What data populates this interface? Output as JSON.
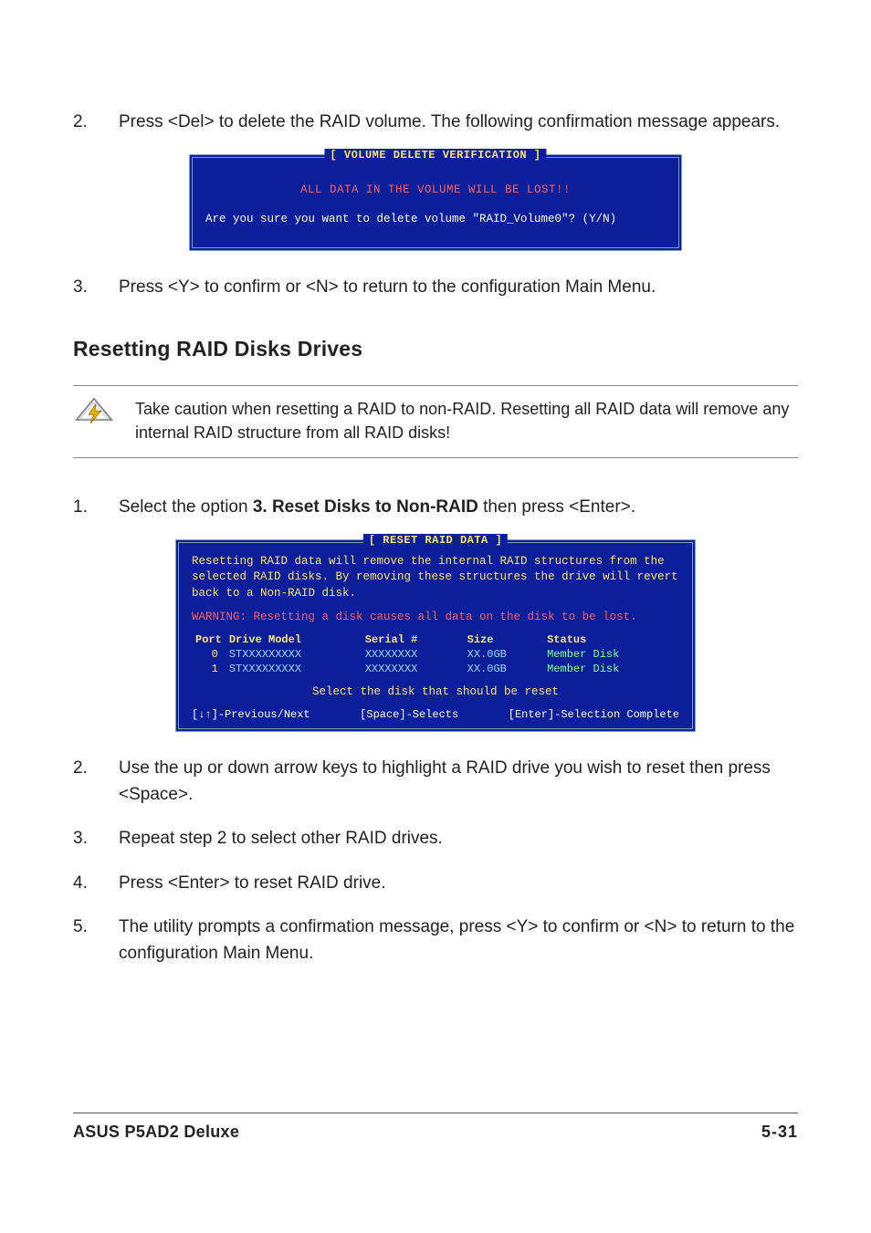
{
  "stepsA": [
    {
      "num": "2.",
      "text": "Press <Del> to delete the RAID volume. The following confirmation message appears."
    }
  ],
  "termA": {
    "title": "[ VOLUME DELETE VERIFICATION ]",
    "warn": "ALL DATA IN THE VOLUME WILL BE LOST!!",
    "question": "Are you sure you want to delete volume \"RAID_Volume0\"? (Y/N)"
  },
  "stepsA2": [
    {
      "num": "3.",
      "text": "Press <Y> to confirm or <N> to return to the configuration Main Menu."
    }
  ],
  "section_heading": "Resetting RAID Disks Drives",
  "callout": "Take caution when resetting a RAID to non-RAID. Resetting all RAID data will remove any internal RAID structure from all RAID disks!",
  "stepsB": [
    {
      "num": "1.",
      "pre": "Select the option ",
      "bold": "3. Reset Disks to Non-RAID",
      "post": " then press <Enter>."
    }
  ],
  "termB": {
    "title": "[ RESET RAID DATA ]",
    "desc": "Resetting RAID data will remove the internal RAID structures from the selected RAID disks. By removing these structures the drive will revert back to a Non-RAID disk.",
    "warn": "WARNING: Resetting a disk causes all data on the disk to be lost.",
    "headers": {
      "port": "Port",
      "model": "Drive Model",
      "serial": "Serial #",
      "size": "Size",
      "status": "Status"
    },
    "rows": [
      {
        "port": "0",
        "model": "STXXXXXXXXX",
        "serial": "XXXXXXXX",
        "size": "XX.0GB",
        "status": "Member Disk"
      },
      {
        "port": "1",
        "model": "STXXXXXXXXX",
        "serial": "XXXXXXXX",
        "size": "XX.0GB",
        "status": "Member Disk"
      }
    ],
    "select_hint": "Select the disk that should be reset",
    "footer": {
      "a": "[↓↑]-Previous/Next",
      "b": "[Space]-Selects",
      "c": "[Enter]-Selection Complete"
    }
  },
  "stepsC": [
    {
      "num": "2.",
      "text": "Use the up or down arrow keys to highlight a RAID drive you wish to reset then press <Space>."
    },
    {
      "num": "3.",
      "text": "Repeat step 2 to select other RAID drives."
    },
    {
      "num": "4.",
      "text": "Press <Enter> to reset RAID drive."
    },
    {
      "num": "5.",
      "text": "The utility prompts a confirmation message, press <Y> to confirm or <N> to return to the configuration Main Menu."
    }
  ],
  "footer": {
    "product": "ASUS P5AD2 Deluxe",
    "page": "5-31"
  }
}
